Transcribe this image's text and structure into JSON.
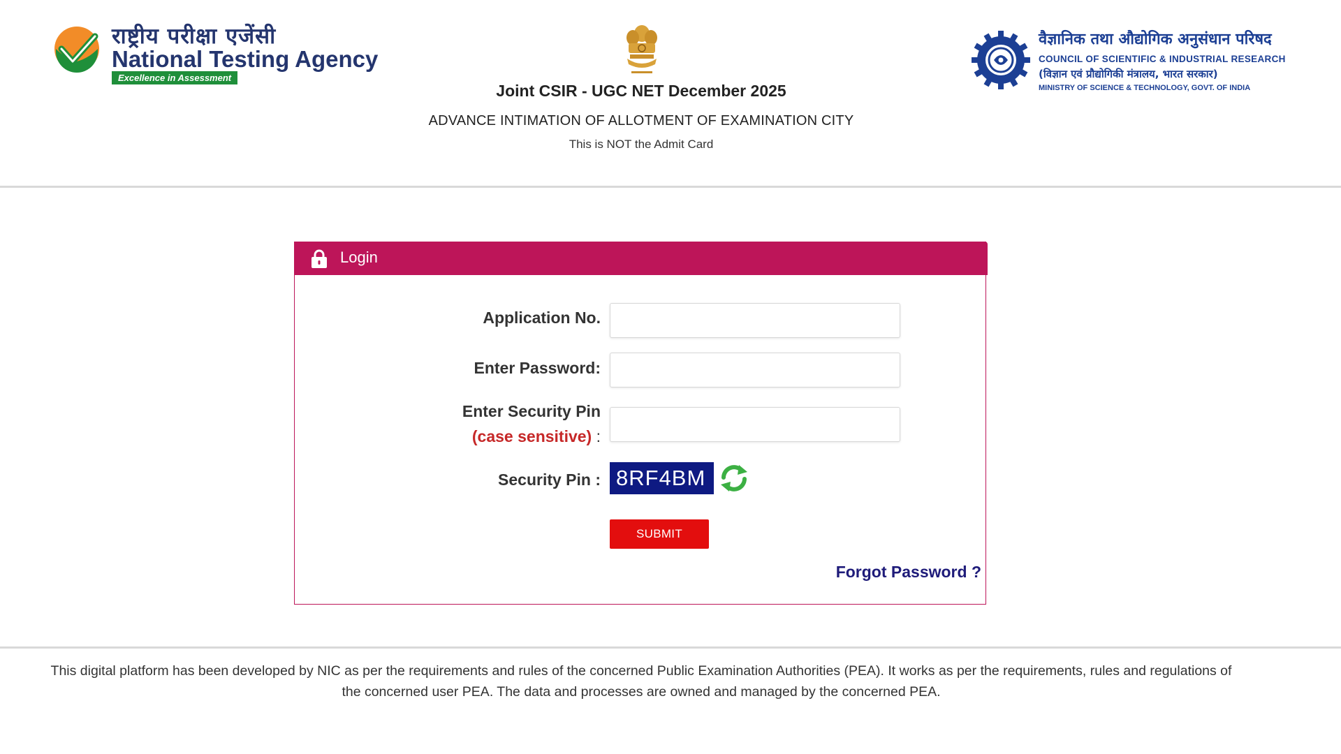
{
  "header": {
    "nta": {
      "hindi": "राष्ट्रीय परीक्षा एजेंसी",
      "english": "National Testing Agency",
      "tagline": "Excellence in Assessment",
      "icon": "nta-check-logo-icon",
      "colors": {
        "orange": "#f28c28",
        "green": "#1f8f3a",
        "navy": "#24356e"
      }
    },
    "emblem_icon": "national-emblem-icon",
    "exam_title": "Joint CSIR - UGC NET December 2025",
    "intimation": "ADVANCE INTIMATION OF ALLOTMENT OF EXAMINATION CITY",
    "notice": "This is NOT the Admit Card",
    "csir": {
      "hindi": "वैज्ञानिक तथा औद्योगिक अनुसंधान परिषद",
      "english": "COUNCIL OF SCIENTIFIC & INDUSTRIAL RESEARCH",
      "hindi_ministry": "(विज्ञान एवं प्रौद्योगिकी मंत्रालय, भारत सरकार)",
      "ministry": "MINISTRY OF SCIENCE & TECHNOLOGY, GOVT. OF INDIA",
      "icon": "csir-gear-logo-icon",
      "color": "#1c3f94"
    }
  },
  "login": {
    "title": "Login",
    "lock_icon": "lock-icon",
    "accent_color": "#bd1559",
    "application_label": "Application No.",
    "application_value": "",
    "password_label": "Enter Password:",
    "password_value": "",
    "pin_label": "Enter Security Pin",
    "pin_case_note": "(case sensitive)",
    "pin_colon": ":",
    "pin_value": "",
    "captcha_label": "Security Pin :",
    "captcha_text": "8RF4BM",
    "refresh_icon": "refresh-icon",
    "submit_label": "SUBMIT",
    "submit_color": "#e30e0e",
    "forgot_label": "Forgot Password ?"
  },
  "footer": {
    "text": "This digital platform has been developed by NIC as per the requirements and rules of the concerned Public Examination Authorities (PEA). It works as per the requirements, rules and regulations of the concerned user PEA. The data and processes are owned and managed by the concerned PEA."
  }
}
